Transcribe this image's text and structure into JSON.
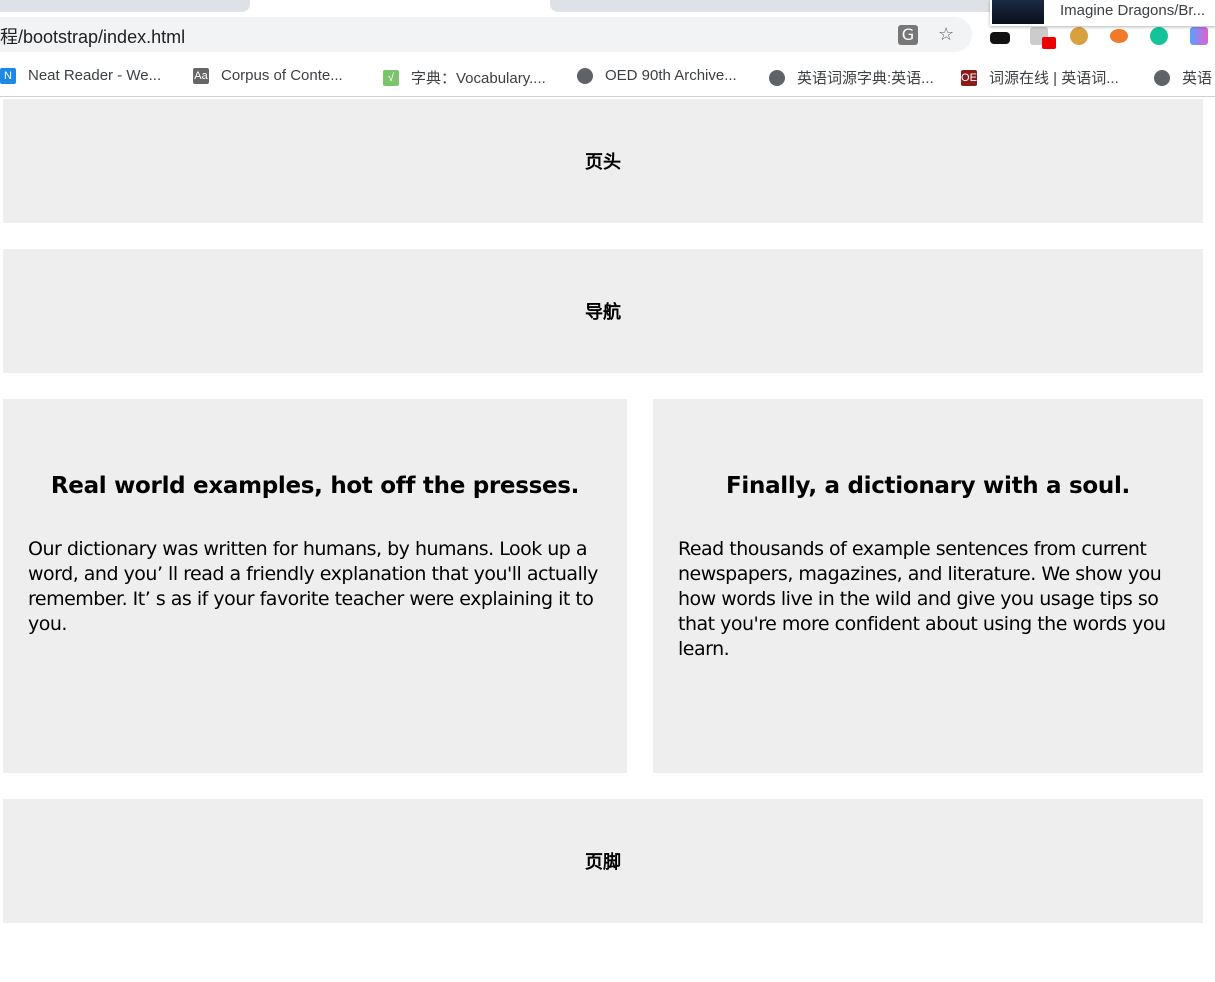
{
  "browser": {
    "url": "程/bootstrap/index.html",
    "media_title": "Imagine Dragons/Br...",
    "omnibox_icons": [
      "translate-icon",
      "star-icon"
    ],
    "extensions": [
      "extension-eyes-icon",
      "extension-puzzle-icon",
      "cookie-icon",
      "chat-icon",
      "grammarly-icon",
      "w-extension-icon"
    ],
    "bookmarks": [
      {
        "label": "Neat Reader - We...",
        "icon": "N",
        "color": "#1e88e5"
      },
      {
        "label": "Corpus of Conte...",
        "icon": "Aa",
        "color": "#666666"
      },
      {
        "label": "字典：Vocabulary....",
        "icon": "√",
        "color": "#7cc36e"
      },
      {
        "label": "OED 90th Archive...",
        "icon": "globe",
        "color": "#5f6368"
      },
      {
        "label": "英语词源字典:英语...",
        "icon": "globe",
        "color": "#5f6368"
      },
      {
        "label": "词源在线 | 英语词...",
        "icon": "OE",
        "color": "#8b1a1a"
      },
      {
        "label": "英语",
        "icon": "globe",
        "color": "#5f6368"
      }
    ]
  },
  "page": {
    "header": "页头",
    "nav": "导航",
    "columns": [
      {
        "title": "Real world examples, hot off the presses.",
        "text": "Our dictionary was written for humans, by humans. Look up a word, and you’ ll read a friendly explanation that you'll actually remember. It’ s as if your favorite teacher were explaining it to you."
      },
      {
        "title": "Finally, a dictionary with a soul.",
        "text": "Read thousands of example sentences from current newspapers, magazines, and literature. We show you how words live in the wild and give you usage tips so that you're more confident about using the words you learn."
      }
    ],
    "footer": "页脚",
    "box_color": "#eeeeee"
  }
}
